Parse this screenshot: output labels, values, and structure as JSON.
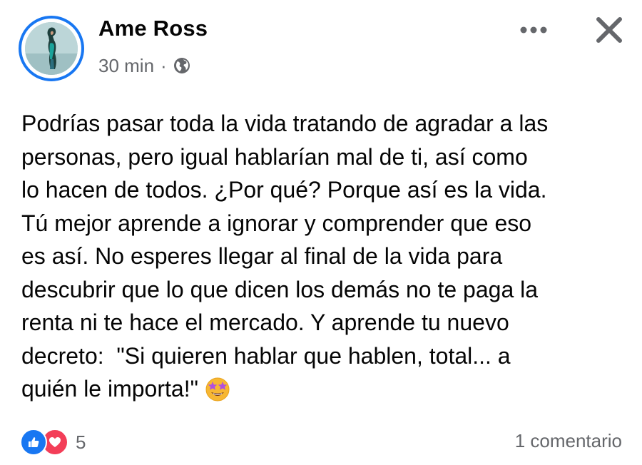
{
  "post": {
    "author": "Ame Ross",
    "time": "30 min",
    "separator": "·",
    "privacy_icon": "globe-icon",
    "more_icon": "more-options-icon",
    "close_icon": "close-icon",
    "text_lines": [
      "Podrías pasar toda la vida tratando de agradar a las",
      "personas, pero igual hablarían mal de ti, así como",
      "lo hacen de todos. ¿Por qué? Porque así es la vida.",
      "Tú mejor aprende a ignorar y comprender que eso",
      "es así. No esperes llegar al final de la vida para",
      "descubrir que lo que dicen los demás no te paga la",
      "renta ni te hace el mercado. Y aprende tu nuevo",
      "decreto:  \"Si quieren hablar que hablen, total... a",
      "quién le importa!\""
    ],
    "text_emoji": "star-struck-emoji"
  },
  "footer": {
    "reactions": [
      "like",
      "love"
    ],
    "reaction_count": "5",
    "comments": "1 comentario"
  },
  "colors": {
    "accent": "#1877f2",
    "love": "#f33e58",
    "secondary_text": "#65676b",
    "primary_text": "#050505"
  }
}
